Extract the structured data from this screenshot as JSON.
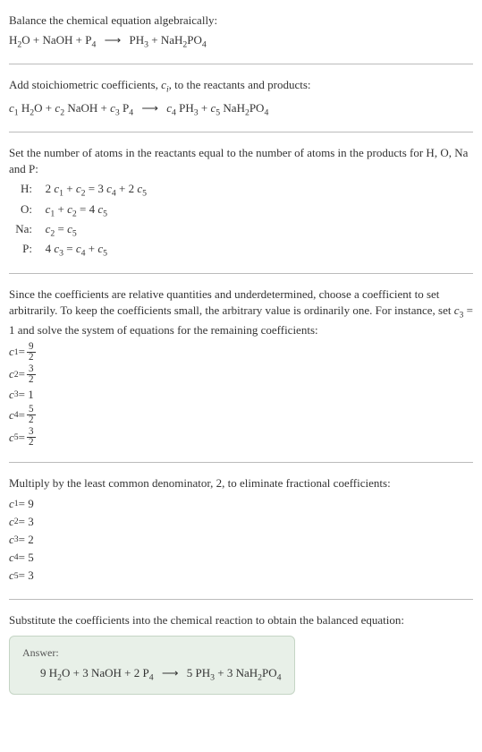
{
  "section1": {
    "intro": "Balance the chemical equation algebraically:",
    "eq_parts": {
      "r1": "H",
      "r1_sub": "2",
      "r1b": "O + NaOH + P",
      "r1_sub2": "4",
      "arrow": "⟶",
      "p1": "PH",
      "p1_sub": "3",
      "p2": " + NaH",
      "p2_sub": "2",
      "p3": "PO",
      "p3_sub": "4"
    }
  },
  "section2": {
    "intro_a": "Add stoichiometric coefficients, ",
    "intro_ci": "c",
    "intro_ci_sub": "i",
    "intro_b": ", to the reactants and products:",
    "eq": {
      "c1": "c",
      "c1s": "1",
      "t1": " H",
      "t1s": "2",
      "t1b": "O + ",
      "c2": "c",
      "c2s": "2",
      "t2": " NaOH + ",
      "c3": "c",
      "c3s": "3",
      "t3": " P",
      "t3s": "4",
      "arrow": "⟶",
      "c4": "c",
      "c4s": "4",
      "t4": " PH",
      "t4s": "3",
      "t4b": " + ",
      "c5": "c",
      "c5s": "5",
      "t5": " NaH",
      "t5s": "2",
      "t5b": "PO",
      "t5s2": "4"
    }
  },
  "section3": {
    "intro": "Set the number of atoms in the reactants equal to the number of atoms in the products for H, O, Na and P:",
    "rows": {
      "h_label": "H:",
      "h_eq_a": "2 ",
      "h_c1": "c",
      "h_c1s": "1",
      "h_eq_b": " + ",
      "h_c2": "c",
      "h_c2s": "2",
      "h_eq_c": " = 3 ",
      "h_c4": "c",
      "h_c4s": "4",
      "h_eq_d": " + 2 ",
      "h_c5": "c",
      "h_c5s": "5",
      "o_label": "O:",
      "o_c1": "c",
      "o_c1s": "1",
      "o_eq_a": " + ",
      "o_c2": "c",
      "o_c2s": "2",
      "o_eq_b": " = 4 ",
      "o_c5": "c",
      "o_c5s": "5",
      "na_label": "Na:",
      "na_c2": "c",
      "na_c2s": "2",
      "na_eq": " = ",
      "na_c5": "c",
      "na_c5s": "5",
      "p_label": "P:",
      "p_eq_a": "4 ",
      "p_c3": "c",
      "p_c3s": "3",
      "p_eq_b": " = ",
      "p_c4": "c",
      "p_c4s": "4",
      "p_eq_c": " + ",
      "p_c5": "c",
      "p_c5s": "5"
    }
  },
  "section4": {
    "intro_a": "Since the coefficients are relative quantities and underdetermined, choose a coefficient to set arbitrarily. To keep the coefficients small, the arbitrary value is ordinarily one. For instance, set ",
    "intro_c3": "c",
    "intro_c3s": "3",
    "intro_b": " = 1 and solve the system of equations for the remaining coefficients:",
    "coefs": {
      "c1": "c",
      "c1s": "1",
      "eq1": " = ",
      "n1": "9",
      "d1": "2",
      "c2": "c",
      "c2s": "2",
      "eq2": " = ",
      "n2": "3",
      "d2": "2",
      "c3": "c",
      "c3s": "3",
      "eq3": " = 1",
      "c4": "c",
      "c4s": "4",
      "eq4": " = ",
      "n4": "5",
      "d4": "2",
      "c5": "c",
      "c5s": "5",
      "eq5": " = ",
      "n5": "3",
      "d5": "2"
    }
  },
  "section5": {
    "intro": "Multiply by the least common denominator, 2, to eliminate fractional coefficients:",
    "coefs": {
      "c1": "c",
      "c1s": "1",
      "v1": " = 9",
      "c2": "c",
      "c2s": "2",
      "v2": " = 3",
      "c3": "c",
      "c3s": "3",
      "v3": " = 2",
      "c4": "c",
      "c4s": "4",
      "v4": " = 5",
      "c5": "c",
      "c5s": "5",
      "v5": " = 3"
    }
  },
  "section6": {
    "intro": "Substitute the coefficients into the chemical reaction to obtain the balanced equation:",
    "answer_label": "Answer:",
    "eq": {
      "a": "9 H",
      "as": "2",
      "b": "O + 3 NaOH + 2 P",
      "bs": "4",
      "arrow": "⟶",
      "c": "5 PH",
      "cs": "3",
      "d": " + 3 NaH",
      "ds": "2",
      "e": "PO",
      "es": "4"
    }
  }
}
